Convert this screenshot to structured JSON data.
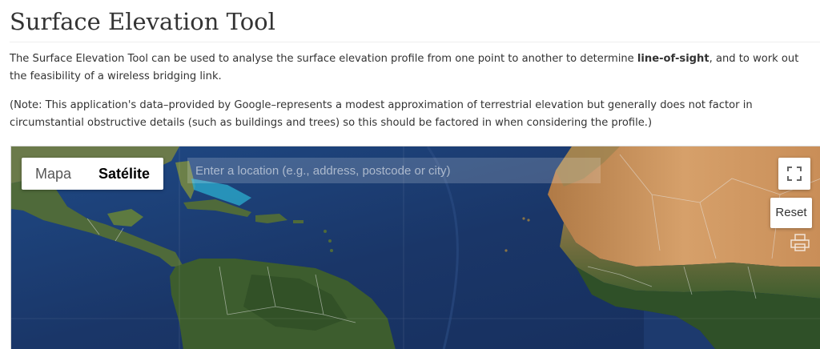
{
  "page": {
    "title": "Surface Elevation Tool"
  },
  "intro": {
    "text_before": "The Surface Elevation Tool can be used to analyse the surface elevation profile from one point to another to determine ",
    "bold": "line-of-sight",
    "text_after": ", and to work out the feasibility of a wireless bridging link."
  },
  "note": {
    "text": "(Note: This application's data–provided by Google–represents a modest approximation of terrestrial elevation but generally does not factor in circumstantial obstructive details (such as buildings and trees) so this should be factored in when considering the profile.)"
  },
  "map": {
    "map_type_options": [
      {
        "label": "Mapa",
        "active": false
      },
      {
        "label": "Satélite",
        "active": true
      }
    ],
    "search": {
      "placeholder": "Enter a location (e.g., address, postcode or city)",
      "value": ""
    },
    "fullscreen_icon": "fullscreen-icon",
    "reset_label": "Reset",
    "print_icon": "print-icon",
    "colors": {
      "ocean": "#1d3a6e",
      "deep_ocean": "#142c58",
      "land_green": "#4a6b3a",
      "desert": "#c9935a",
      "shallow_water": "#2aa6c9"
    }
  }
}
